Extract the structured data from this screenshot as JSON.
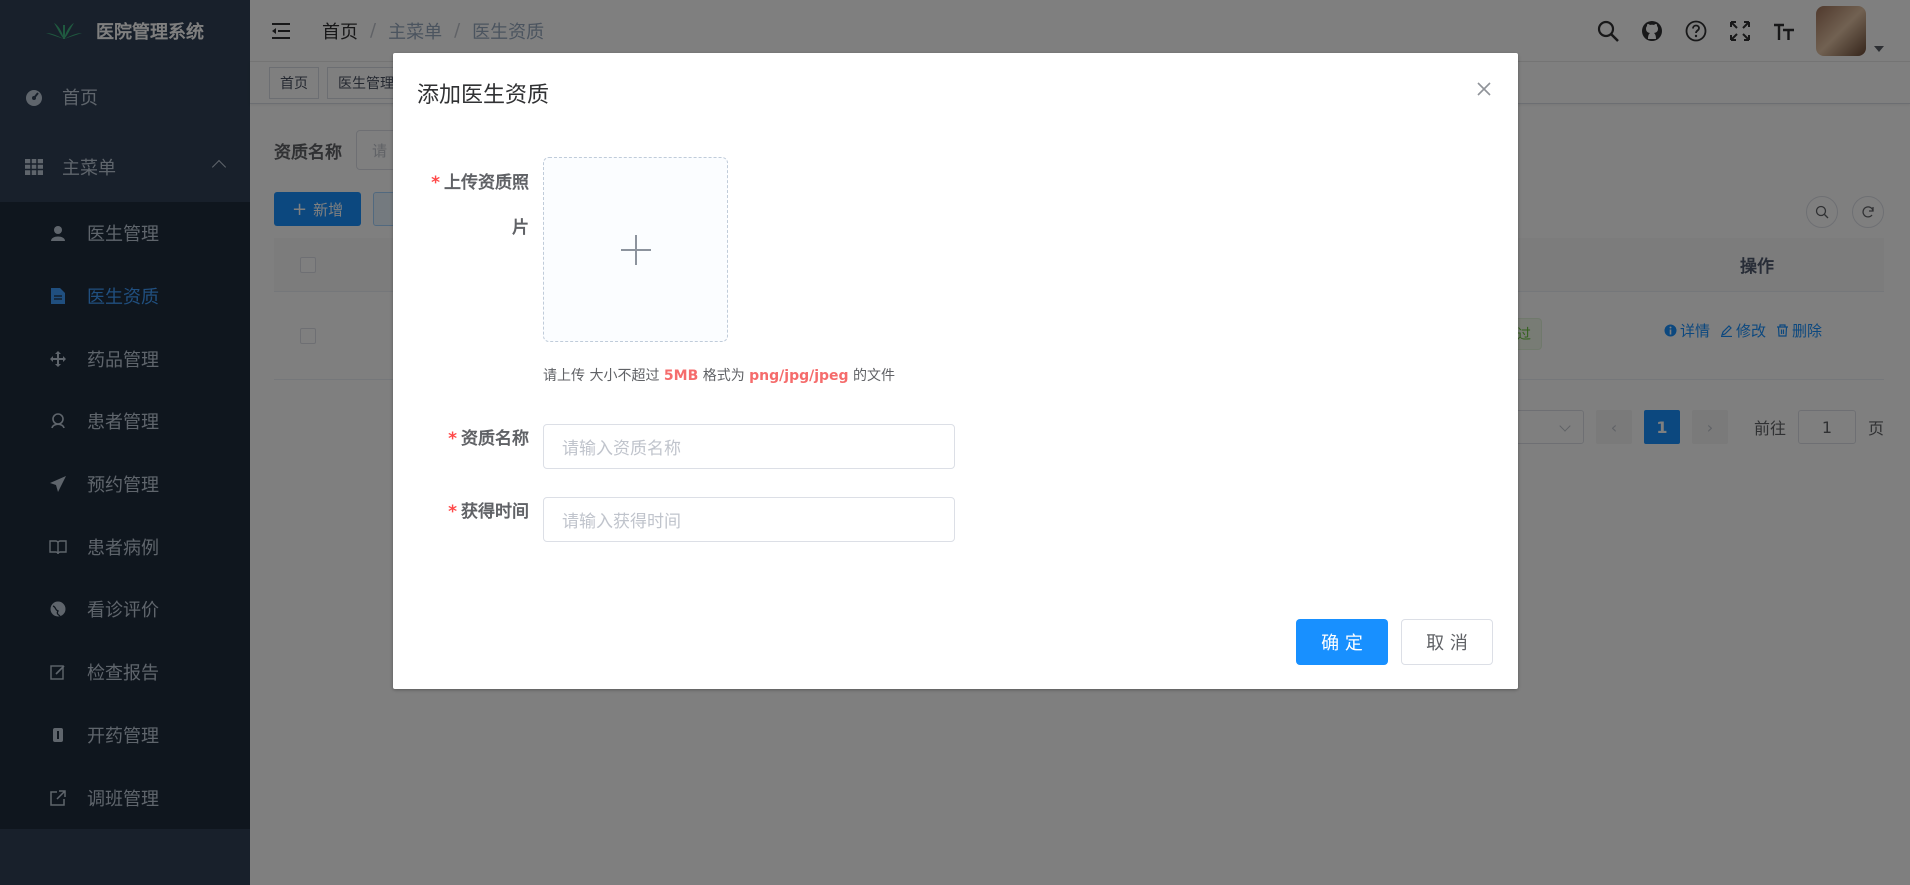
{
  "app": {
    "title": "医院管理系统"
  },
  "sidebar": {
    "home": "首页",
    "main_menu": "主菜单",
    "items": [
      {
        "label": "医生管理",
        "icon": "user-icon"
      },
      {
        "label": "医生资质",
        "icon": "document-icon",
        "active": true
      },
      {
        "label": "药品管理",
        "icon": "move-icon"
      },
      {
        "label": "患者管理",
        "icon": "people-icon"
      },
      {
        "label": "预约管理",
        "icon": "send-icon"
      },
      {
        "label": "患者病例",
        "icon": "book-icon"
      },
      {
        "label": "看诊评价",
        "icon": "globe-icon"
      },
      {
        "label": "检查报告",
        "icon": "edit-icon"
      },
      {
        "label": "开药管理",
        "icon": "pill-icon"
      },
      {
        "label": "调班管理",
        "icon": "external-link-icon"
      }
    ]
  },
  "breadcrumb": [
    "首页",
    "主菜单",
    "医生资质"
  ],
  "tags": [
    "首页",
    "医生管理"
  ],
  "search": {
    "label": "资质名称",
    "placeholder": "请"
  },
  "toolbar": {
    "add_label": "新增"
  },
  "table": {
    "op_header": "操作",
    "row_status_fragment": "过",
    "ops": [
      "详情",
      "修改",
      "删除"
    ]
  },
  "pagination": {
    "current": "1",
    "goto_label": "前往",
    "goto_value": "1",
    "page_label": "页"
  },
  "dialog": {
    "title": "添加医生资质",
    "upload_label_line1": "上传资质照",
    "upload_label_line2": "片",
    "upload_tip_prefix": "请上传 大小不超过 ",
    "upload_tip_size": "5MB",
    "upload_tip_mid": " 格式为 ",
    "upload_tip_formats": "png/jpg/jpeg",
    "upload_tip_suffix": " 的文件",
    "name_label": "资质名称",
    "name_placeholder": "请输入资质名称",
    "time_label": "获得时间",
    "time_placeholder": "请输入获得时间",
    "confirm": "确 定",
    "cancel": "取 消"
  },
  "colors": {
    "sidebar_bg": "#304156",
    "submenu_bg": "#1f2d3d",
    "primary": "#1890ff",
    "active_text": "#409eff",
    "required": "#ff4949"
  }
}
